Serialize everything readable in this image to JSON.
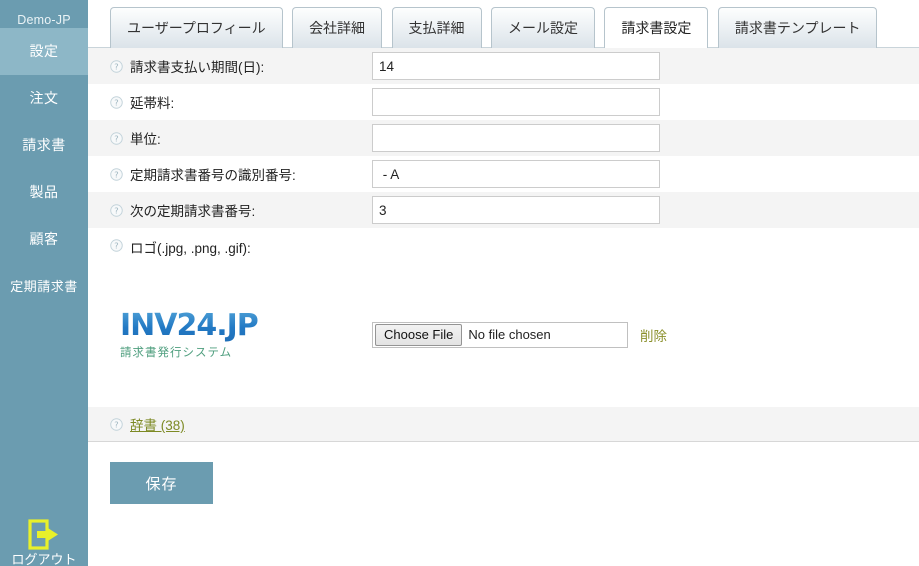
{
  "sidebar": {
    "brand": "Demo-JP",
    "items": [
      {
        "label": "設定",
        "active": true
      },
      {
        "label": "注文",
        "active": false
      },
      {
        "label": "請求書",
        "active": false
      },
      {
        "label": "製品",
        "active": false
      },
      {
        "label": "顧客",
        "active": false
      },
      {
        "label": "定期請求書",
        "active": false
      }
    ],
    "logout": {
      "label": "ログアウト",
      "icon": "logout-icon",
      "color": "#e8f02a"
    },
    "bg_color": "#6b9cb0",
    "active_bg_color": "#8db7c7"
  },
  "tabs": [
    {
      "label": "ユーザープロフィール",
      "active": false
    },
    {
      "label": "会社詳細",
      "active": false
    },
    {
      "label": "支払詳細",
      "active": false
    },
    {
      "label": "メール設定",
      "active": false
    },
    {
      "label": "請求書設定",
      "active": true
    },
    {
      "label": "請求書テンプレート",
      "active": false
    }
  ],
  "form": {
    "rows": [
      {
        "label": "請求書支払い期間(日):",
        "value": "14",
        "placeholder": ""
      },
      {
        "label": "延帯料:",
        "value": "",
        "placeholder": ""
      },
      {
        "label": "単位:",
        "value": "",
        "placeholder": ""
      },
      {
        "label": "定期請求書番号の識別番号:",
        "value": " - A",
        "placeholder": ""
      },
      {
        "label": "次の定期請求書番号:",
        "value": "3",
        "placeholder": ""
      }
    ],
    "logo": {
      "label": "ロゴ(.jpg, .png, .gif):",
      "brand_main": "INV24.JP",
      "brand_sub": "請求書発行システム",
      "choose_file_label": "Choose File",
      "file_status": "No file chosen",
      "delete_label": "削除"
    },
    "dictionary": {
      "label": "辞書 (38)"
    }
  },
  "actions": {
    "save_label": "保存"
  },
  "colors": {
    "accent_teal": "#6b9cb0",
    "link_olive": "#7d8a24",
    "logo_blue": "#2279c4",
    "logo_green": "#4e9e7e",
    "row_alt": "#f4f4f4"
  }
}
